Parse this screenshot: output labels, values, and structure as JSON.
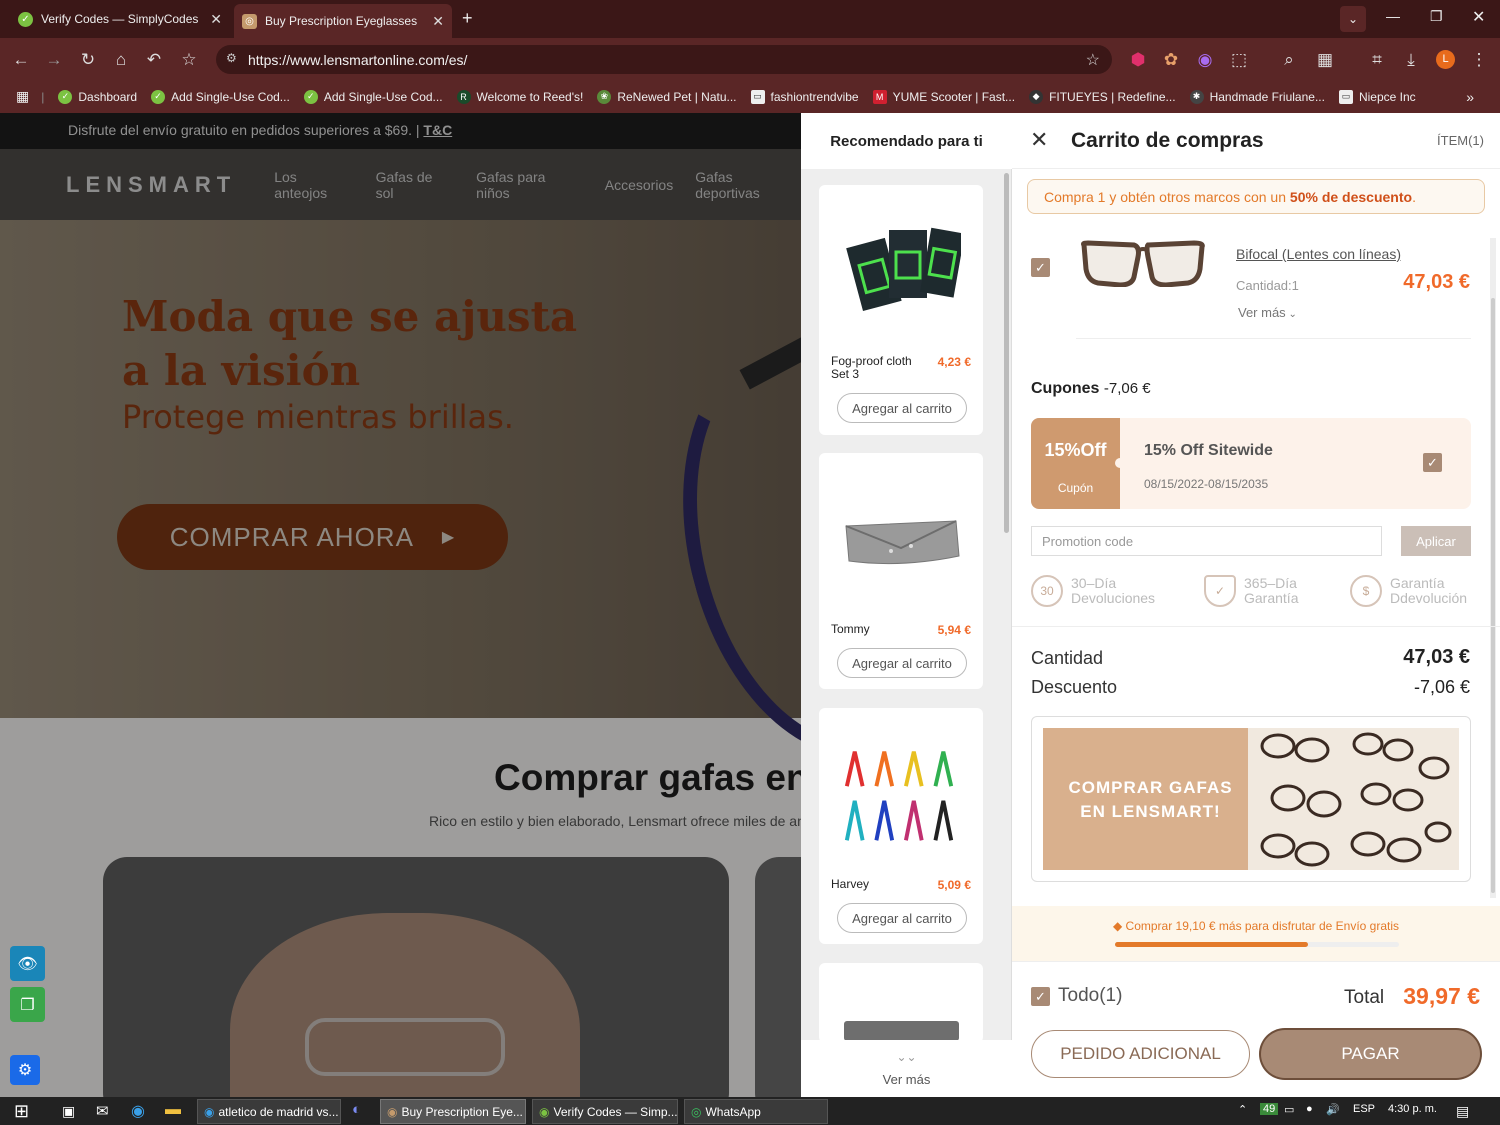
{
  "browser": {
    "tabs": [
      {
        "title": "Verify Codes — SimplyCodes",
        "icon": "simplycodes-icon"
      },
      {
        "title": "Buy Prescription Eyeglasses Onl",
        "icon": "lensmart-icon"
      }
    ],
    "url": "https://www.lensmartonline.com/es/",
    "profile_initial": "L",
    "bookmarks": [
      "Dashboard",
      "Add Single-Use Cod...",
      "Add Single-Use Cod...",
      "Welcome to Reed's!",
      "ReNewed Pet | Natu...",
      "fashiontrendvibe",
      "YUME Scooter | Fast...",
      "FITUEYES | Redefine...",
      "Handmade Friulane...",
      "Niepce Inc"
    ]
  },
  "site": {
    "promo_text": "Disfrute del envío gratuito en pedidos superiores a $69. |",
    "promo_link": "T&C",
    "logo": "LENSMART",
    "nav": [
      "Los anteojos",
      "Gafas de sol",
      "Gafas para niños",
      "Accesorios",
      "Gafas deportivas"
    ],
    "hero_line1": "Moda que se ajusta",
    "hero_line2": "a la visión",
    "hero_sub": "Protege mientras brillas.",
    "hero_cta": "COMPRAR AHORA",
    "section_title": "Comprar gafas en",
    "section_sub": "Rico en estilo y bien elaborado, Lensmart ofrece miles de ante"
  },
  "recommend": {
    "title": "Recomendado para ti",
    "items": [
      {
        "name": "Fog-proof cloth Set 3",
        "price": "4,23 €",
        "button": "Agregar al carrito"
      },
      {
        "name": "Tommy",
        "price": "5,94 €",
        "button": "Agregar al carrito"
      },
      {
        "name": "Harvey",
        "price": "5,09 €",
        "button": "Agregar al carrito"
      }
    ],
    "more": "Ver más"
  },
  "cart": {
    "title": "Carrito de compras",
    "item_count": "ÍTEM(1)",
    "banner_pre": "Compra 1 y obtén otros marcos con un ",
    "banner_bold": "50% de descuento",
    "banner_post": ".",
    "item": {
      "name": "Bifocal (Lentes con líneas)",
      "qty": "Cantidad:1",
      "price": "47,03 €",
      "more": "Ver más"
    },
    "coupons_label": "Cupones",
    "coupons_value": "-7,06 €",
    "coupon": {
      "badge": "15%Off",
      "badge_sub": "Cupón",
      "title": "15% Off Sitewide",
      "dates": "08/15/2022-08/15/2035"
    },
    "promo_placeholder": "Promotion code",
    "apply": "Aplicar",
    "features": [
      {
        "icon": "30",
        "line1": "30–Día",
        "line2": "Devoluciones"
      },
      {
        "icon": "✓",
        "line1": "365–Día",
        "line2": "Garantía"
      },
      {
        "icon": "$",
        "line1": "Garantía",
        "line2": "Ddevolución"
      }
    ],
    "qty_label": "Cantidad",
    "qty_value": "47,03 €",
    "discount_label": "Descuento",
    "discount_value": "-7,06 €",
    "ad_text_line1": "COMPRAR GAFAS",
    "ad_text_line2": "EN LENSMART!",
    "shipping_text": "Comprar 19,10 € más para disfrutar de Envío gratis",
    "shipping_progress": 0.68,
    "all_label": "Todo(1)",
    "total_label": "Total",
    "total_value": "39,97 €",
    "btn_additional": "PEDIDO ADICIONAL",
    "btn_pay": "PAGAR"
  },
  "taskbar": {
    "items": [
      "atletico de madrid vs...",
      "Buy Prescription Eye...",
      "Verify Codes — Simp...",
      "WhatsApp"
    ],
    "battery": "49",
    "lang": "ESP",
    "time": "4:30 p. m."
  },
  "colors": {
    "accent": "#e37a2a",
    "brand_brown": "#a88a75",
    "chrome": "#5a2626"
  }
}
